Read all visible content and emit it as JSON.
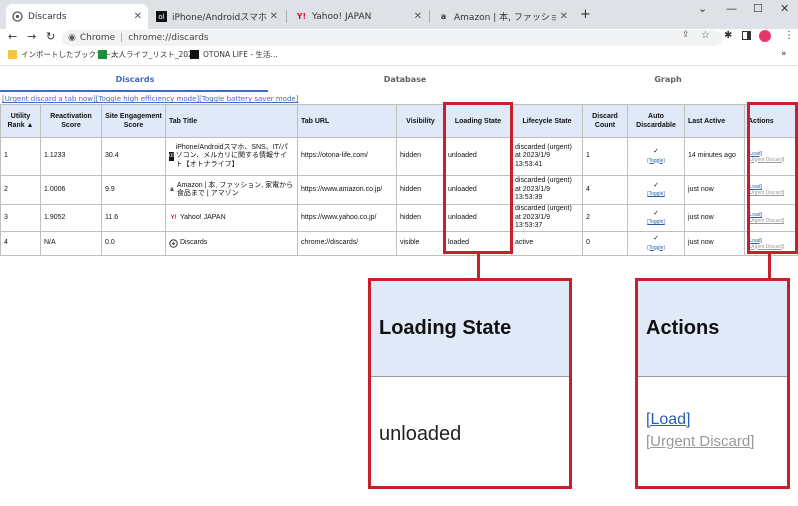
{
  "browser": {
    "tabs": [
      {
        "title": "Discards",
        "active": true,
        "favicon": "chrome-gear-icon"
      },
      {
        "title": "iPhone/Androidスマホ、SNS、IT/パソ",
        "active": false,
        "favicon": "otona-life-icon"
      },
      {
        "title": "Yahoo! JAPAN",
        "active": false,
        "favicon": "yahoo-icon"
      },
      {
        "title": "Amazon | 本, ファッション, 家電から食",
        "active": false,
        "favicon": "amazon-icon"
      }
    ],
    "omnibox": {
      "site": "Chrome",
      "url": "chrome://discards"
    },
    "bookmarks": [
      {
        "label": "インポートしたブックマー...",
        "icon": "folder-icon"
      },
      {
        "label": "大人ライフ_リスト_202...",
        "icon": "sheets-icon"
      },
      {
        "label": "OTONA LIFE - 生活...",
        "icon": "otona-life-icon"
      }
    ]
  },
  "page": {
    "nav_tabs": [
      "Discards",
      "Database",
      "Graph"
    ],
    "action_links": [
      "[Urgent discard a tab now]",
      "[Toggle high efficiency mode]",
      "[Toggle battery saver mode]"
    ],
    "columns": [
      "Utility Rank ▲",
      "Reactivation Score",
      "Site Engagement Score",
      "Tab Title",
      "Tab URL",
      "Visibility",
      "Loading State",
      "Lifecycle State",
      "Discard Count",
      "Auto Discardable",
      "Last Active",
      "Actions"
    ],
    "rows": [
      {
        "rank": "1",
        "reactivation": "1.1233",
        "engagement": "30.4",
        "title": "iPhone/Androidスマホ、SNS、IT/パソコン、メルカリに関する情報サイト【オトナライフ】",
        "favicon": "otona-life-icon",
        "url": "https://otona-life.com/",
        "visibility": "hidden",
        "loading": "unloaded",
        "lifecycle": "discarded (urgent) at 2023/1/9 13:53:41",
        "discard_count": "1",
        "auto": "✓",
        "toggle": "[Toggle]",
        "last_active": "14 minutes ago",
        "load": "[Load]",
        "urgent": "[Urgent Discard]"
      },
      {
        "rank": "2",
        "reactivation": "1.0006",
        "engagement": "9.9",
        "title": "Amazon | 本, ファッション, 家電から食品まで | アマゾン",
        "favicon": "amazon-icon",
        "url": "https://www.amazon.co.jp/",
        "visibility": "hidden",
        "loading": "unloaded",
        "lifecycle": "discarded (urgent) at 2023/1/9 13:53:39",
        "discard_count": "4",
        "auto": "✓",
        "toggle": "[Toggle]",
        "last_active": "just now",
        "load": "[Load]",
        "urgent": "[Urgent Discard]"
      },
      {
        "rank": "3",
        "reactivation": "1.9052",
        "engagement": "11.6",
        "title": "Yahoo! JAPAN",
        "favicon": "yahoo-icon",
        "url": "https://www.yahoo.co.jp/",
        "visibility": "hidden",
        "loading": "unloaded",
        "lifecycle": "discarded (urgent) at 2023/1/9 13:53:37",
        "discard_count": "2",
        "auto": "✓",
        "toggle": "[Toggle]",
        "last_active": "just now",
        "load": "[Load]",
        "urgent": "[Urgent Discard]"
      },
      {
        "rank": "4",
        "reactivation": "N/A",
        "engagement": "0.0",
        "title": "Discards",
        "favicon": "chrome-gear-icon",
        "url": "chrome://discards/",
        "visibility": "visible",
        "loading": "loaded",
        "lifecycle": "active",
        "discard_count": "0",
        "auto": "✓",
        "toggle": "[Toggle]",
        "last_active": "just now",
        "load": "[Load]",
        "urgent": "[Urgent Discard]"
      }
    ]
  },
  "zoom": {
    "loading": {
      "header": "Loading State",
      "value": "unloaded"
    },
    "actions": {
      "header": "Actions",
      "load": "[Load]",
      "urgent": "[Urgent Discard]"
    }
  },
  "colors": {
    "highlight": "#c8202b",
    "header_bg": "#dfe9f7",
    "link": "#2a5db0"
  }
}
